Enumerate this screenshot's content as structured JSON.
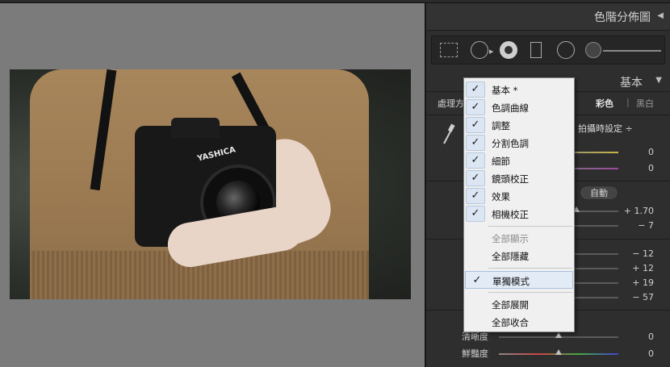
{
  "panel": {
    "title": "色階分佈圖",
    "section_title": "基本",
    "treatment_label": "處理方",
    "treatment_color": "彩色",
    "treatment_separator": "|",
    "treatment_bw": "黑白",
    "wb_value": "拍攝時設定 ÷",
    "auto_label": "自動",
    "values": {
      "temp": "0",
      "tint": "0",
      "exposure": "+ 1.70",
      "contrast": "− 7",
      "highlights": "− 12",
      "shadows": "+ 12",
      "whites": "+ 19",
      "blacks": "− 57",
      "clarity": "0",
      "vibrance": "0"
    },
    "labels": {
      "clarity": "清晰度",
      "vibrance": "鮮豔度"
    }
  },
  "photo": {
    "brand": "YASHICA"
  },
  "menu": {
    "items": [
      {
        "label": "基本 *",
        "checked": true
      },
      {
        "label": "色調曲線",
        "checked": true
      },
      {
        "label": "調整",
        "checked": true
      },
      {
        "label": "分割色調",
        "checked": true
      },
      {
        "label": "細節",
        "checked": true
      },
      {
        "label": "鏡頭校正",
        "checked": true
      },
      {
        "label": "效果",
        "checked": true
      },
      {
        "label": "相機校正",
        "checked": true
      }
    ],
    "show_all": "全部顯示",
    "hide_all": "全部隱藏",
    "solo_mode": "單獨模式",
    "expand_all": "全部展開",
    "collapse_all": "全部收合",
    "check_glyph": "✓"
  }
}
